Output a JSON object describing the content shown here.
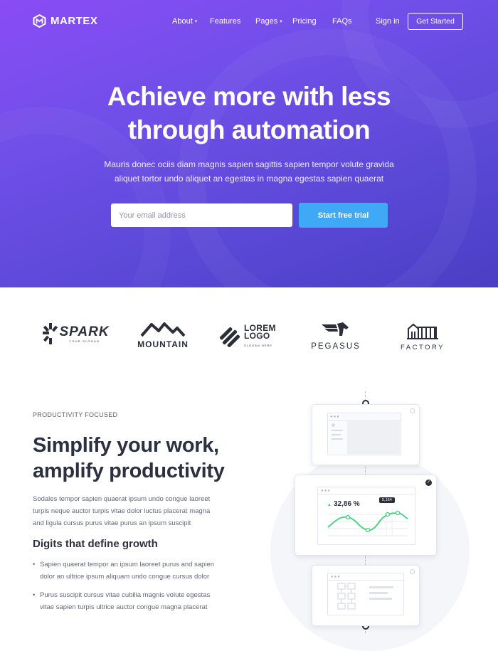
{
  "brand": {
    "name": "MARTEX"
  },
  "nav": {
    "items": [
      {
        "label": "About",
        "dropdown": true
      },
      {
        "label": "Features",
        "dropdown": false
      },
      {
        "label": "Pages",
        "dropdown": true
      },
      {
        "label": "Pricing",
        "dropdown": false
      },
      {
        "label": "FAQs",
        "dropdown": false
      }
    ],
    "sign_in": "Sign in",
    "get_started": "Get Started"
  },
  "hero": {
    "title_line1": "Achieve more with less",
    "title_line2": "through automation",
    "subtitle_line1": "Mauris donec ociis diam magnis sapien sagittis sapien tempor volute gravida",
    "subtitle_line2": "aliquet tortor undo aliquet an egestas in magna egestas sapien quaerat",
    "email_placeholder": "Your email address",
    "cta": "Start free trial"
  },
  "logos": [
    {
      "name": "SPARK",
      "tagline": "YOUR SLOGAN"
    },
    {
      "name": "MOUNTAIN"
    },
    {
      "name_line1": "LOREM",
      "name_line2": "LOGO",
      "tagline": "SLOGAN HERE"
    },
    {
      "name": "PEGASUS"
    },
    {
      "name": "FACTORY"
    }
  ],
  "feature": {
    "eyebrow": "PRODUCTIVITY FOCUSED",
    "headline_line1": "Simplify your work,",
    "headline_line2": "amplify productivity",
    "paragraph_line1": "Sodales tempor sapien quaerat ipsum undo congue laoreet",
    "paragraph_line2": "turpis neque auctor turpis vitae dolor luctus placerat magna",
    "paragraph_line3": "and ligula cursus purus vitae purus an ipsum suscipit",
    "subheading": "Digits that define growth",
    "bullets": [
      {
        "line1": "Sapien quaerat tempor an ipsum laoreet purus and sapien",
        "line2": "dolor an ultrice ipsum aliquam undo congue cursus dolor"
      },
      {
        "line1": "Purus suscipit cursus vitae cubilia magnis volute egestas",
        "line2": "vitae sapien turpis ultrice auctor congue magna placerat"
      }
    ]
  },
  "illustration": {
    "stat_value": "32,86 %",
    "tooltip": "5,164"
  },
  "colors": {
    "hero_start": "#8a4cf5",
    "hero_end": "#4a3fc4",
    "cta": "#3fa9f5",
    "chart_line": "#3fd27a"
  }
}
